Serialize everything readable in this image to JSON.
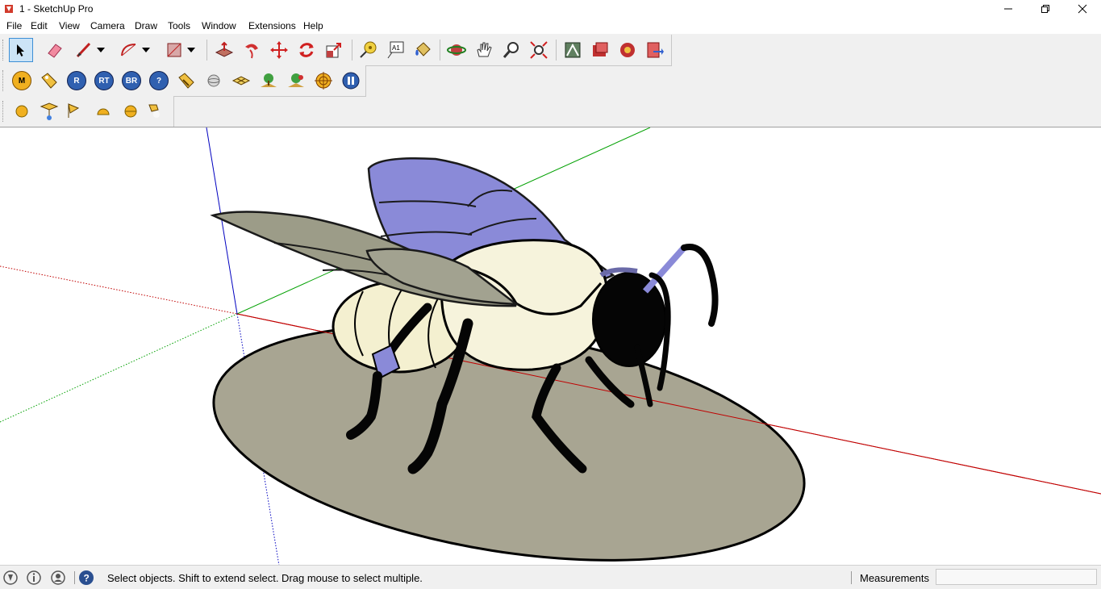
{
  "window": {
    "title": "1 - SketchUp Pro",
    "minimize_icon": "minimize-icon",
    "maximize_icon": "restore-icon",
    "close_icon": "close-icon"
  },
  "menu": [
    "File",
    "Edit",
    "View",
    "Camera",
    "Draw",
    "Tools",
    "Window",
    "Extensions",
    "Help"
  ],
  "toolbar_main": [
    "select-tool-icon",
    "eraser-icon",
    "pencil-line-icon",
    "arc-icon",
    "rectangle-icon",
    "push-pull-icon",
    "follow-me-icon",
    "move-icon",
    "rotate-icon",
    "scale-icon",
    "tape-measure-icon",
    "text-icon",
    "paint-bucket-icon",
    "orbit-icon",
    "pan-icon",
    "zoom-icon",
    "zoom-extents-icon",
    "warehouse-icon",
    "extension-warehouse-icon",
    "layout-icon",
    "send-to-layout-icon"
  ],
  "toolbar_render": [
    "M",
    "tag",
    "R",
    "RT",
    "BR",
    "?",
    "pen",
    "sphere",
    "grid",
    "env1",
    "env2",
    "target",
    "pause"
  ],
  "toolbar_lights": [
    "sphere-light-icon",
    "spot-light-icon",
    "flag-light-icon",
    "dome-light-icon",
    "half-sphere-icon",
    "cone-light-icon"
  ],
  "status": {
    "message": "Select objects. Shift to extend select. Drag mouse to select multiple.",
    "measurements_label": "Measurements",
    "measurements_value": ""
  },
  "colors": {
    "wing_back": "#8a8ad8",
    "wing_front": "#9c9c88",
    "body": "#f4f0d0",
    "base": "#a8a592",
    "axis_red": "#c00000",
    "axis_green": "#00a000",
    "axis_blue": "#0000c0"
  }
}
